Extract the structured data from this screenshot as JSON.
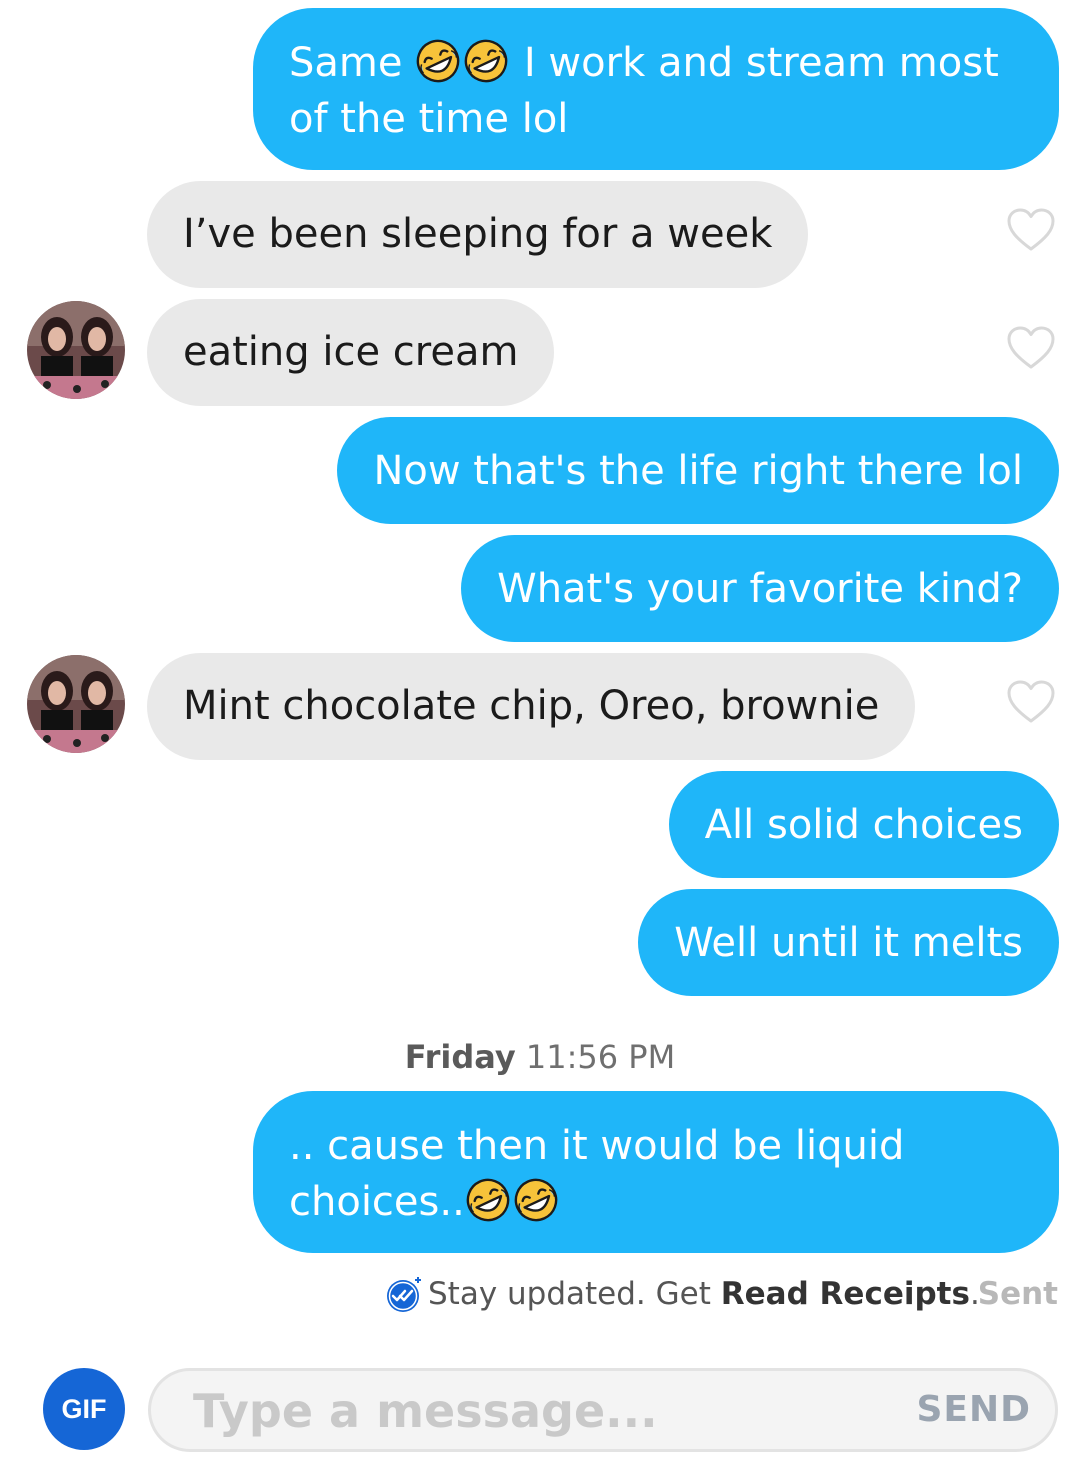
{
  "colors": {
    "outgoing_bubble": "#1fb6f9",
    "incoming_bubble": "#e9e9e9",
    "gif_button": "#1566d6",
    "receipt_check": "#1566d6"
  },
  "messages": [
    {
      "direction": "out",
      "text_a": "Same ",
      "emoji_a": "rolling-on-floor-laughing x2",
      "text_b": " I work and stream most of the time lol"
    },
    {
      "direction": "in",
      "text": "I’ve been sleeping for a week"
    },
    {
      "direction": "in",
      "text": "eating ice cream"
    },
    {
      "direction": "out",
      "text": "Now that's the life right there lol"
    },
    {
      "direction": "out",
      "text": "What's your favorite kind?"
    },
    {
      "direction": "in",
      "text": "Mint chocolate chip, Oreo, brownie"
    },
    {
      "direction": "out",
      "text": "All solid choices"
    },
    {
      "direction": "out",
      "text": "Well until it melts"
    },
    {
      "direction": "out",
      "text_a": ".. cause then it would be liquid choices..",
      "emoji_a": "rolling-on-floor-laughing x2"
    }
  ],
  "timestamp": {
    "day": "Friday",
    "time": " 11:56 PM"
  },
  "receipt": {
    "prefix": "Stay updated. Get ",
    "link": "Read Receipts",
    "suffix": ".",
    "status": "Sent"
  },
  "composer": {
    "gif_label": "GIF",
    "placeholder": "Type a message...",
    "send_label": "SEND"
  },
  "icons": {
    "like": "heart-outline-icon",
    "emoji": "rolling-on-floor-laughing-emoji",
    "receipt": "double-check-circle-icon"
  }
}
